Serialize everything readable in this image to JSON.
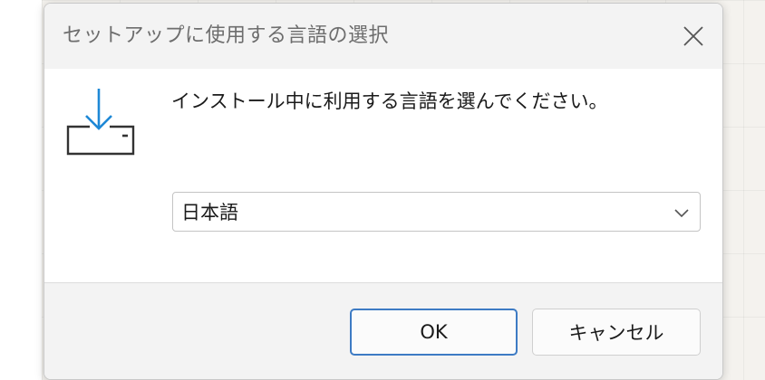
{
  "dialog": {
    "title": "セットアップに使用する言語の選択",
    "prompt": "インストール中に利用する言語を選んでください。",
    "icon": "download-install-icon",
    "language_select": {
      "selected": "日本語"
    },
    "buttons": {
      "ok": "OK",
      "cancel": "キャンセル"
    }
  },
  "colors": {
    "accent": "#3d7bc4",
    "icon_blue": "#1e88d6"
  }
}
